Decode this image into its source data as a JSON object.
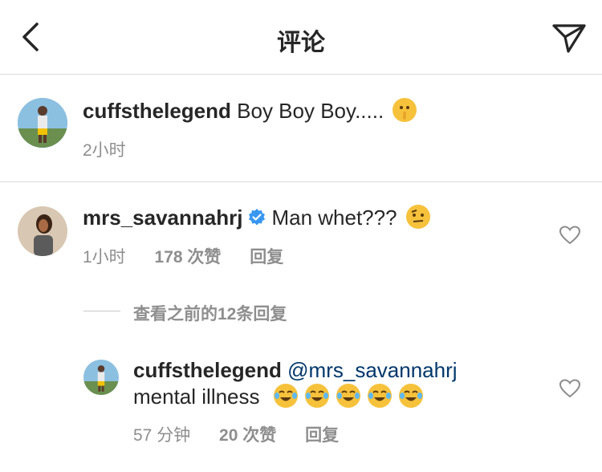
{
  "header": {
    "title": "评论"
  },
  "caption": {
    "username": "cuffsthelegend",
    "text": "Boy Boy Boy.....",
    "emoji": "shushing-face-emoji",
    "time": "2小时"
  },
  "comment": {
    "username": "mrs_savannahrj",
    "verified": true,
    "text": "Man whet???",
    "emoji": "raised-eyebrow-face-emoji",
    "time": "1小时",
    "likes": "178 次赞",
    "reply_label": "回复"
  },
  "view_replies": {
    "label": "查看之前的12条回复"
  },
  "reply": {
    "username": "cuffsthelegend",
    "mention": "@mrs_savannahrj",
    "text": "mental illness",
    "emoji": "face-with-tears-of-joy-emoji",
    "emoji_count": 5,
    "time": "57 分钟",
    "likes": "20 次赞",
    "reply_label": "回复"
  },
  "colors": {
    "text": "#262626",
    "secondary": "#8e8e8e",
    "mention": "#00376b",
    "verified": "#3897f0",
    "emoji": "#f7c23b"
  }
}
